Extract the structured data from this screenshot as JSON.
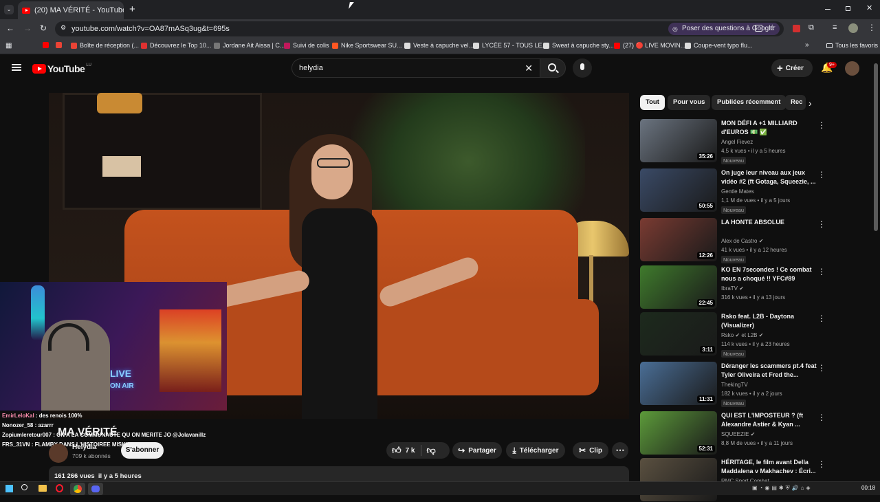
{
  "browser": {
    "tab_title": "(20) MA VÉRITÉ - YouTube",
    "new_tab": "+",
    "url": "youtube.com/watch?v=OA87mASq3ug&t=695s",
    "ask_google": "Poser des questions à Google",
    "window_controls": [
      "minimize-icon",
      "restore-icon",
      "close-icon"
    ]
  },
  "bookmarks": [
    {
      "label": "",
      "color": "#ff0000"
    },
    {
      "label": "",
      "color": "#ea4335"
    },
    {
      "label": "Boîte de réception (...",
      "color": "#ea4335"
    },
    {
      "label": "Découvrez le Top 10...",
      "color": "#e03131"
    },
    {
      "label": "Jordane Ait Aissa | C...",
      "color": "#777777"
    },
    {
      "label": "Suivi de colis",
      "color": "#c2185b"
    },
    {
      "label": "Nike Sportswear SU...",
      "color": "#ff5722"
    },
    {
      "label": "Veste à capuche vel...",
      "color": "#dddddd"
    },
    {
      "label": "LYCÉE 57 - TOUS LE...",
      "color": "#dddddd"
    },
    {
      "label": "Sweat à capuche sty...",
      "color": "#dddddd"
    },
    {
      "label": "(27) 🔴 LIVE MOVIN...",
      "color": "#ff0000"
    },
    {
      "label": "Coupe-vent typo flu...",
      "color": "#dddddd"
    }
  ],
  "all_bookmarks": "Tous les favoris",
  "youtube": {
    "logo": "YouTube",
    "country": "LU",
    "search_value": "helydia",
    "create_label": "Créer",
    "notif_count": "9+"
  },
  "video": {
    "title": "MA VÉRITÉ",
    "channel": "Helydia",
    "subscribers": "709 k abonnés",
    "subscribe": "S'abonner",
    "likes": "7 k",
    "share": "Partager",
    "download": "Télécharger",
    "clip": "Clip",
    "views_line": "161 266 vues  il y a 5 heures"
  },
  "chat": [
    {
      "user": "EmirLeloKal",
      "msg": "des renois 100%",
      "color": "#ff8fb1"
    },
    {
      "user": "Nonozer_58",
      "msg": "azarrr",
      "color": "#ffffff"
    },
    {
      "user": "Zopiumleretour007",
      "msg": "ON A LA COMMUNAUTE QU ON MERITE JO @Jolavanillz",
      "color": "#ffffff"
    },
    {
      "user": "FRS_31VN",
      "msg": "FLAMBY DANS L'HISTOIREE MISKINE",
      "color": "#ffffff"
    }
  ],
  "chips": [
    "Tout",
    "Pour vous",
    "Publiées récemment",
    "Rec"
  ],
  "recs": [
    {
      "title": "MON DÉFI A +1 MILLIARD d'EUROS 💵 ✅",
      "channel": "Angel Fievez",
      "meta": "4,5 k vues • il y a 5 heures",
      "badge": "Nouveau",
      "duration": "35:26",
      "thumb": "#6b7480"
    },
    {
      "title": "On juge leur niveau aux jeux vidéo #2 (ft Gotaga, Squeezie, ...",
      "channel": "Gentle Mates",
      "meta": "1,1 M de vues • il y a 5 jours",
      "badge": "Nouveau",
      "duration": "50:55",
      "thumb": "#3a4a66"
    },
    {
      "title": "LA HONTE ABSOLUE",
      "channel": "Alex de Castro ✔",
      "meta": "41 k vues • il y a 12 heures",
      "badge": "Nouveau",
      "duration": "12:26",
      "thumb": "#7a3b32"
    },
    {
      "title": "KO EN 7secondes ! Ce combat nous a choqué !! YFC#89",
      "channel": "IbraTV ✔",
      "meta": "316 k vues • il y a 13 jours",
      "badge": "",
      "duration": "22:45",
      "thumb": "#3f7a2c"
    },
    {
      "title": "Rsko feat. L2B - Daytona (Visualizer)",
      "channel": "Rsko ✔ et L2B ✔",
      "meta": "114 k vues • il y a 23 heures",
      "badge": "Nouveau",
      "duration": "3:11",
      "thumb": "#1d2a1d"
    },
    {
      "title": "Déranger les scammers pt.4 feat Tyler Oliveira et Fred the...",
      "channel": "ThekingTV",
      "meta": "182 k vues • il y a 2 jours",
      "badge": "Nouveau",
      "duration": "11:31",
      "thumb": "#4a6e96"
    },
    {
      "title": "QUI EST L'IMPOSTEUR ? (ft Alexandre Astier & Kyan ...",
      "channel": "SQUEEZIE ✔",
      "meta": "8,8 M de vues • il y a 11 jours",
      "badge": "",
      "duration": "52:31",
      "thumb": "#5c9a3a"
    },
    {
      "title": "HÉRITAGE, le film avant Della Maddalena v Makhachev : Écri...",
      "channel": "RMC Sport Combat",
      "meta": "",
      "badge": "",
      "duration": "",
      "thumb": "#5a5040"
    }
  ],
  "taskbar": {
    "time": "00:18"
  }
}
